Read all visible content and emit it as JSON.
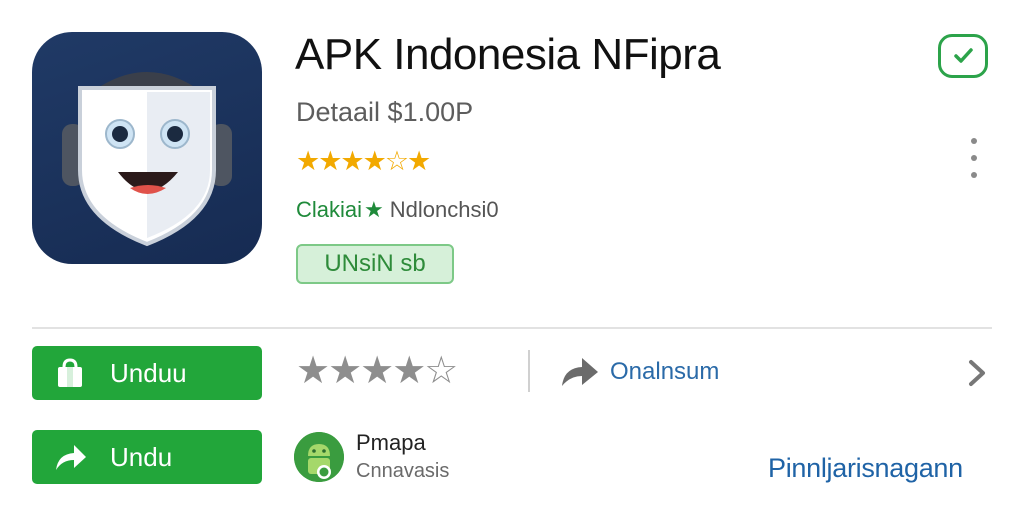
{
  "app": {
    "title": "APK Indonesia NFipra",
    "detail": "Detaail  $1.00P",
    "stars_glyphs": "★★★★☆★",
    "rating_stars_level": 4.5,
    "category_label": "Clakiai",
    "category_value": "Ndlonchsi0",
    "badge_label": "UNsiN sb",
    "icon_name": "shield-mascot-app-icon"
  },
  "actions": {
    "download_label": "Unduu",
    "share_button_label": "Undu",
    "share_text": "Onalnsum",
    "rating_glyphs": "★★★★☆",
    "rating_value": 4
  },
  "developer": {
    "name": "Pmapa",
    "sub": "Cnnavasis",
    "more_link": "Pinnljarisnagann"
  },
  "icons": {
    "verified": "check-badge-icon",
    "more": "more-vertical-icon",
    "download": "shopping-bag-icon",
    "share": "share-arrow-icon",
    "chevron": "chevron-right-icon",
    "developer": "android-avatar-icon"
  },
  "colors": {
    "primary_green": "#22a63a",
    "star_gold": "#f2a900",
    "link_blue": "#1f63a6",
    "icon_navy": "#1b3260"
  }
}
